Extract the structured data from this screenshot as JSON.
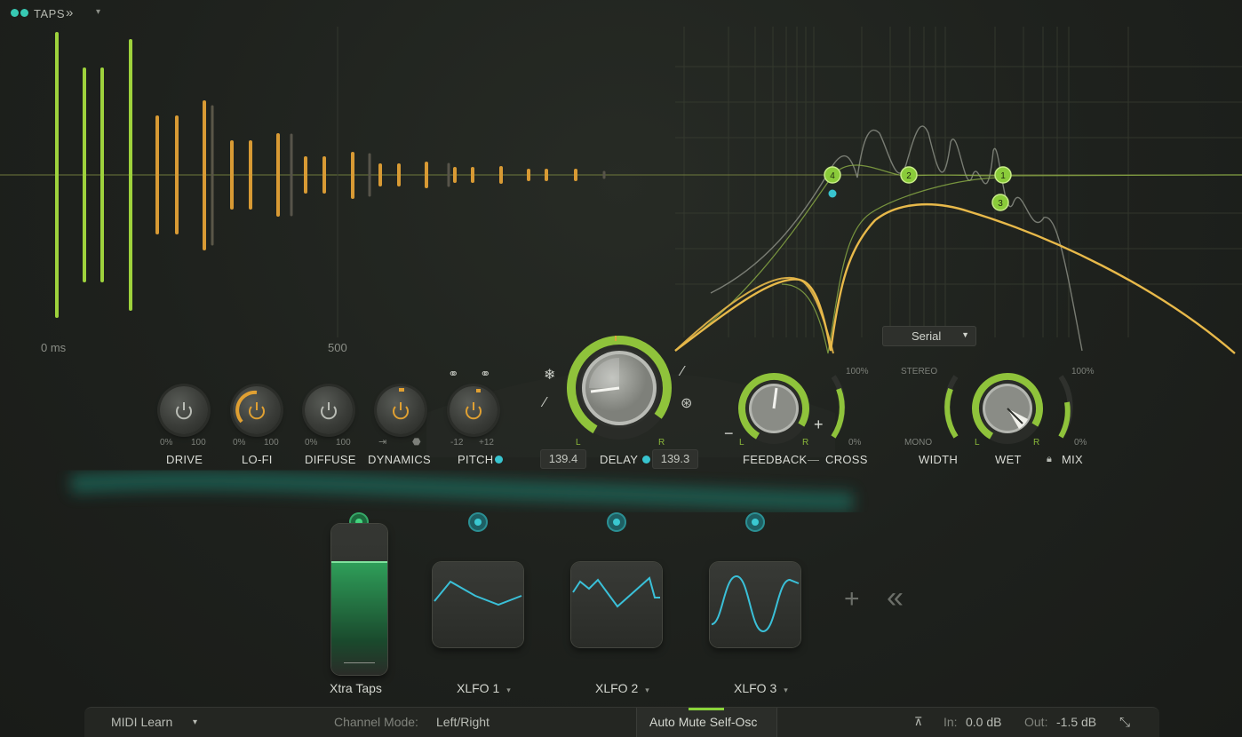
{
  "header": {
    "tab_label": "TAPS",
    "chevron": "»",
    "dropdown": "▾"
  },
  "tap_display": {
    "time_start": "0 ms",
    "time_mid": "500"
  },
  "routing": {
    "mode": "Serial"
  },
  "filter_nodes": [
    "4",
    "2",
    "1",
    "3"
  ],
  "knobs": {
    "drive": {
      "label": "DRIVE",
      "min": "0%",
      "max": "100"
    },
    "lofi": {
      "label": "LO-FI",
      "min": "0%",
      "max": "100"
    },
    "diffuse": {
      "label": "DIFFUSE",
      "min": "0%",
      "max": "100"
    },
    "dynamics": {
      "label": "DYNAMICS"
    },
    "pitch": {
      "label": "PITCH",
      "min": "-12",
      "max": "+12"
    },
    "delay": {
      "label": "DELAY",
      "left_value": "139.4",
      "right_value": "139.3",
      "left_ch": "L",
      "right_ch": "R"
    },
    "feedback": {
      "label": "FEEDBACK",
      "dash": "—",
      "minus": "−",
      "plus": "+",
      "left_ch": "L",
      "right_ch": "R"
    },
    "cross": {
      "label": "CROSS",
      "max": "100%",
      "min": "0%"
    },
    "width": {
      "label": "WIDTH",
      "top": "STEREO",
      "bottom": "MONO"
    },
    "wet": {
      "label": "WET",
      "left_ch": "L",
      "right_ch": "R"
    },
    "mix": {
      "label": "MIX",
      "max": "100%",
      "min": "0%"
    }
  },
  "modulators": [
    {
      "label": "Xtra Taps"
    },
    {
      "label": "XLFO 1",
      "arrow": "▾"
    },
    {
      "label": "XLFO 2",
      "arrow": "▾"
    },
    {
      "label": "XLFO 3",
      "arrow": "▾"
    }
  ],
  "mod_actions": {
    "add": "+",
    "collapse": "«"
  },
  "footer": {
    "midi_learn": "MIDI Learn",
    "midi_arrow": "▾",
    "channel_mode_label": "Channel Mode:",
    "channel_mode_value": "Left/Right",
    "auto_mute": "Auto Mute Self-Osc",
    "in_label": "In:",
    "in_value": "0.0 dB",
    "out_label": "Out:",
    "out_value": "-1.5 dB"
  },
  "colors": {
    "accent_green": "#9acb3a",
    "accent_orange": "#d9a23a",
    "accent_teal": "#38c4cf",
    "curve_yellow": "#e8b94a"
  }
}
